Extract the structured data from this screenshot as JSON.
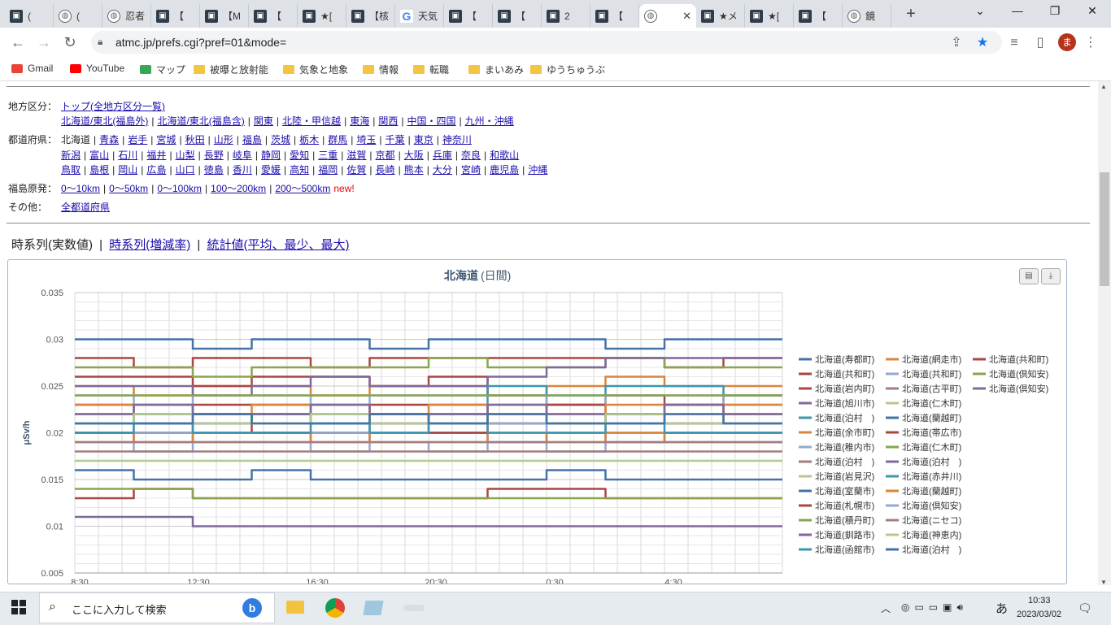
{
  "browser": {
    "tabs": [
      {
        "label": "(",
        "icon": "site-icon"
      },
      {
        "label": "(",
        "icon": "globe-icon"
      },
      {
        "label": "忍者",
        "icon": "globe-icon"
      },
      {
        "label": "【",
        "icon": "site-icon"
      },
      {
        "label": "【M",
        "icon": "site-icon"
      },
      {
        "label": "【",
        "icon": "site-icon"
      },
      {
        "label": "★[",
        "icon": "site-icon"
      },
      {
        "label": "【核",
        "icon": "site-icon"
      },
      {
        "label": "天気",
        "icon": "google-icon"
      },
      {
        "label": "【",
        "icon": "site-icon"
      },
      {
        "label": "【",
        "icon": "site-icon"
      },
      {
        "label": "2",
        "icon": "site-icon"
      },
      {
        "label": "【",
        "icon": "site-icon"
      },
      {
        "label": "",
        "icon": "globe-icon",
        "active": true
      },
      {
        "label": "★メ",
        "icon": "site-icon"
      },
      {
        "label": "★[",
        "icon": "site-icon"
      },
      {
        "label": "【",
        "icon": "site-icon"
      },
      {
        "label": "鏡",
        "icon": "globe-icon"
      }
    ],
    "url": "atmc.jp/prefs.cgi?pref=01&mode=",
    "avatar": "ま",
    "bookmarks": [
      {
        "label": "Gmail",
        "icon": "gmail-icon"
      },
      {
        "label": "YouTube",
        "icon": "youtube-icon"
      },
      {
        "label": "マップ",
        "icon": "maps-icon"
      },
      {
        "label": "被曝と放射能",
        "icon": "folder-icon"
      },
      {
        "label": "気象と地象",
        "icon": "folder-icon"
      },
      {
        "label": "情報",
        "icon": "folder-icon"
      },
      {
        "label": "転職",
        "icon": "folder-icon"
      },
      {
        "label": "まいあみ",
        "icon": "folder-icon"
      },
      {
        "label": "ゆうちゅうぶ",
        "icon": "folder-icon"
      }
    ]
  },
  "nav": {
    "region_label": "地方区分：",
    "region_line1": [
      "トップ(全地方区分一覧)"
    ],
    "region_line2": [
      "北海道/東北(福島外)",
      "北海道/東北(福島含)",
      "関東",
      "北陸・甲信越",
      "東海",
      "関西",
      "中国・四国",
      "九州・沖縄"
    ],
    "pref_label": "都道府県：",
    "pref_current": "北海道",
    "pref_line1": [
      "青森",
      "岩手",
      "宮城",
      "秋田",
      "山形",
      "福島",
      "茨城",
      "栃木",
      "群馬",
      "埼玉",
      "千葉",
      "東京",
      "神奈川"
    ],
    "pref_line2": [
      "新潟",
      "富山",
      "石川",
      "福井",
      "山梨",
      "長野",
      "岐阜",
      "静岡",
      "愛知",
      "三重",
      "滋賀",
      "京都",
      "大阪",
      "兵庫",
      "奈良",
      "和歌山"
    ],
    "pref_line3": [
      "鳥取",
      "島根",
      "岡山",
      "広島",
      "山口",
      "徳島",
      "香川",
      "愛媛",
      "高知",
      "福岡",
      "佐賀",
      "長崎",
      "熊本",
      "大分",
      "宮崎",
      "鹿児島",
      "沖縄"
    ],
    "fukushima_label": "福島原発：",
    "fukushima_links": [
      "0〜10km",
      "0〜50km",
      "0〜100km",
      "100〜200km",
      "200〜500km"
    ],
    "new_badge": "new!",
    "other_label": "その他：",
    "other_links": [
      "全都道府県"
    ]
  },
  "view_tabs": {
    "current": "時系列(実数値)",
    "link1": "時系列(増減率)",
    "link2": "統計値(平均、最少、最大)"
  },
  "chart_data": {
    "type": "line",
    "title": "北海道",
    "subtitle": "(日間)",
    "ylabel": "μSv/h",
    "ylim": [
      0.005,
      0.035
    ],
    "yticks": [
      "0.035",
      "0.03",
      "0.025",
      "0.02",
      "0.015",
      "0.01",
      "0.005"
    ],
    "xticks": [
      "8:30",
      "12:30",
      "16:30",
      "20:30",
      "0:30",
      "4:30"
    ],
    "series": [
      {
        "name": "北海道(寿都町)",
        "color": "#4572a7",
        "values": [
          0.03,
          0.03,
          0.029,
          0.03,
          0.03,
          0.029,
          0.03,
          0.03,
          0.03,
          0.029,
          0.03,
          0.03
        ]
      },
      {
        "name": "北海道(網走市)",
        "color": "#db843d",
        "values": [
          0.025,
          0.024,
          0.025,
          0.025,
          0.024,
          0.025,
          0.025,
          0.024,
          0.025,
          0.026,
          0.025,
          0.025
        ]
      },
      {
        "name": "北海道(共和町)",
        "color": "#aa4643",
        "values": [
          0.028,
          0.027,
          0.028,
          0.028,
          0.027,
          0.028,
          0.028,
          0.028,
          0.028,
          0.028,
          0.027,
          0.028
        ]
      },
      {
        "name": "北海道(共和町)",
        "color": "#aa4643",
        "values": [
          0.026,
          0.026,
          0.025,
          0.026,
          0.026,
          0.025,
          0.026,
          0.024,
          0.023,
          0.024,
          0.023,
          0.024
        ]
      },
      {
        "name": "北海道(共和町)",
        "color": "#93a9cf",
        "values": [
          0.024,
          0.023,
          0.024,
          0.024,
          0.023,
          0.024,
          0.024,
          0.024,
          0.023,
          0.024,
          0.024,
          0.023
        ]
      },
      {
        "name": "北海道(倶知安)",
        "color": "#89a54e",
        "values": [
          0.027,
          0.027,
          0.026,
          0.027,
          0.027,
          0.027,
          0.028,
          0.027,
          0.027,
          0.028,
          0.027,
          0.027
        ]
      },
      {
        "name": "北海道(岩内町)",
        "color": "#aa4643",
        "values": [
          0.023,
          0.022,
          0.023,
          0.023,
          0.022,
          0.023,
          0.023,
          0.022,
          0.023,
          0.022,
          0.023,
          0.022
        ]
      },
      {
        "name": "北海道(古平町)",
        "color": "#a47d7c",
        "values": [
          0.022,
          0.021,
          0.022,
          0.021,
          0.022,
          0.021,
          0.022,
          0.022,
          0.021,
          0.022,
          0.021,
          0.022
        ]
      },
      {
        "name": "北海道(倶知安)",
        "color": "#80699b",
        "values": [
          0.025,
          0.025,
          0.024,
          0.025,
          0.026,
          0.025,
          0.025,
          0.026,
          0.027,
          0.028,
          0.028,
          0.028
        ]
      },
      {
        "name": "北海道(旭川市)",
        "color": "#80699b",
        "values": [
          0.02,
          0.019,
          0.02,
          0.02,
          0.019,
          0.02,
          0.02,
          0.019,
          0.02,
          0.019,
          0.02,
          0.02
        ]
      },
      {
        "name": "北海道(仁木町)",
        "color": "#b5ca92",
        "values": [
          0.022,
          0.022,
          0.021,
          0.022,
          0.022,
          0.021,
          0.022,
          0.022,
          0.021,
          0.022,
          0.021,
          0.022
        ]
      },
      {
        "name": "北海道(泊村　)",
        "color": "#3d96ae",
        "values": [
          0.021,
          0.021,
          0.021,
          0.022,
          0.021,
          0.021,
          0.022,
          0.021,
          0.021,
          0.022,
          0.021,
          0.021
        ]
      },
      {
        "name": "北海道(蘭越町)",
        "color": "#4572a7",
        "values": [
          0.02,
          0.02,
          0.02,
          0.02,
          0.02,
          0.02,
          0.02,
          0.02,
          0.02,
          0.02,
          0.02,
          0.02
        ]
      },
      {
        "name": "北海道(余市町)",
        "color": "#db843d",
        "values": [
          0.019,
          0.02,
          0.019,
          0.019,
          0.02,
          0.019,
          0.019,
          0.02,
          0.019,
          0.02,
          0.019,
          0.019
        ]
      },
      {
        "name": "北海道(帯広市)",
        "color": "#aa4643",
        "values": [
          0.013,
          0.014,
          0.013,
          0.013,
          0.013,
          0.013,
          0.013,
          0.014,
          0.014,
          0.013,
          0.013,
          0.013
        ]
      },
      {
        "name": "北海道(稚内市)",
        "color": "#93a9cf",
        "values": [
          0.019,
          0.018,
          0.019,
          0.019,
          0.018,
          0.019,
          0.018,
          0.019,
          0.018,
          0.019,
          0.019,
          0.019
        ]
      },
      {
        "name": "北海道(仁木町)",
        "color": "#89a54e",
        "values": [
          0.014,
          0.014,
          0.013,
          0.013,
          0.013,
          0.013,
          0.013,
          0.013,
          0.013,
          0.013,
          0.013,
          0.013
        ]
      },
      {
        "name": "北海道(泊村　)",
        "color": "#a47d7c",
        "values": [
          0.018,
          0.018,
          0.018,
          0.018,
          0.018,
          0.018,
          0.018,
          0.018,
          0.018,
          0.018,
          0.018,
          0.018
        ]
      },
      {
        "name": "北海道(泊村　)",
        "color": "#80699b",
        "values": [
          0.011,
          0.011,
          0.01,
          0.01,
          0.01,
          0.01,
          0.01,
          0.01,
          0.01,
          0.01,
          0.01,
          0.01
        ]
      },
      {
        "name": "北海道(岩見沢)",
        "color": "#b5ca92",
        "values": [
          0.017,
          0.017,
          0.017,
          0.017,
          0.017,
          0.017,
          0.017,
          0.017,
          0.017,
          0.017,
          0.017,
          0.017
        ]
      },
      {
        "name": "北海道(赤井川)",
        "color": "#3d96ae",
        "values": [
          0.021,
          0.022,
          0.021,
          0.022,
          0.021,
          0.022,
          0.021,
          0.025,
          0.024,
          0.025,
          0.025,
          0.024
        ]
      },
      {
        "name": "北海道(室蘭市)",
        "color": "#4572a7",
        "values": [
          0.016,
          0.015,
          0.015,
          0.016,
          0.015,
          0.015,
          0.015,
          0.015,
          0.016,
          0.015,
          0.015,
          0.015
        ]
      },
      {
        "name": "北海道(蘭越町)",
        "color": "#db843d",
        "values": [
          0.023,
          0.023,
          0.022,
          0.023,
          0.023,
          0.022,
          0.023,
          0.023,
          0.022,
          0.023,
          0.022,
          0.023
        ]
      },
      {
        "name": "北海道(札幌市)",
        "color": "#aa4643",
        "values": [
          0.02,
          0.02,
          0.021,
          0.02,
          0.02,
          0.021,
          0.02,
          0.021,
          0.021,
          0.022,
          0.021,
          0.021
        ]
      },
      {
        "name": "北海道(倶知安)",
        "color": "#93a9cf",
        "values": [
          0.021,
          0.02,
          0.021,
          0.021,
          0.02,
          0.021,
          0.021,
          0.021,
          0.02,
          0.021,
          0.021,
          0.021
        ]
      },
      {
        "name": "北海道(積丹町)",
        "color": "#89a54e",
        "values": [
          0.024,
          0.024,
          0.024,
          0.024,
          0.024,
          0.024,
          0.024,
          0.024,
          0.024,
          0.024,
          0.024,
          0.024
        ]
      },
      {
        "name": "北海道(ニセコ)",
        "color": "#a47d7c",
        "values": [
          0.019,
          0.019,
          0.019,
          0.019,
          0.019,
          0.019,
          0.019,
          0.019,
          0.019,
          0.019,
          0.019,
          0.019
        ]
      },
      {
        "name": "北海道(釧路市)",
        "color": "#80699b",
        "values": [
          0.022,
          0.023,
          0.022,
          0.022,
          0.023,
          0.022,
          0.022,
          0.023,
          0.022,
          0.022,
          0.023,
          0.022
        ]
      },
      {
        "name": "北海道(神恵内)",
        "color": "#b5ca92",
        "values": [
          0.021,
          0.022,
          0.021,
          0.021,
          0.022,
          0.021,
          0.021,
          0.022,
          0.021,
          0.022,
          0.021,
          0.021
        ]
      },
      {
        "name": "北海道(函館市)",
        "color": "#3d96ae",
        "values": [
          0.02,
          0.021,
          0.02,
          0.02,
          0.021,
          0.02,
          0.021,
          0.02,
          0.02,
          0.021,
          0.02,
          0.02
        ]
      },
      {
        "name": "北海道(泊村　)",
        "color": "#4572a7",
        "values": [
          0.021,
          0.021,
          0.022,
          0.021,
          0.021,
          0.022,
          0.021,
          0.022,
          0.021,
          0.021,
          0.022,
          0.021
        ]
      }
    ]
  },
  "taskbar": {
    "search_placeholder": "ここに入力して検索",
    "time": "10:33",
    "date": "2023/03/02",
    "ime": "あ"
  }
}
